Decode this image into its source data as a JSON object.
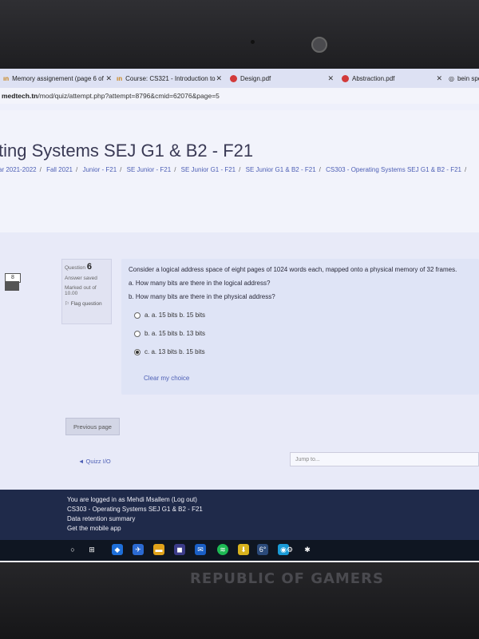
{
  "tabs": [
    {
      "label": "Memory assignement (page 6 of",
      "favicon": "moodle-icon"
    },
    {
      "label": "Course: CS321 - Introduction to",
      "favicon": "moodle-icon"
    },
    {
      "label": "Design.pdf",
      "favicon": "pdf-icon"
    },
    {
      "label": "Abstraction.pdf",
      "favicon": "pdf-icon"
    },
    {
      "label": "bein spo",
      "favicon": "globe-icon"
    }
  ],
  "url": {
    "domain": "medtech.tn",
    "path": "/mod/quiz/attempt.php?attempt=8796&cmid=62076&page=5"
  },
  "course_title": "ting Systems SEJ G1 & B2 - F21",
  "breadcrumbs": [
    "ar 2021-2022",
    "Fall 2021",
    "Junior - F21",
    "SE Junior - F21",
    "SE Junior G1 - F21",
    "SE Junior G1 & B2 - F21",
    "CS303 - Operating Systems SEJ G1 & B2 - F21"
  ],
  "quiz_nav": {
    "current": "8"
  },
  "question_info": {
    "label": "Question",
    "number": "6",
    "status": "Answer saved",
    "marked_line1": "Marked out of",
    "marked_line2": "10.00",
    "flag": "Flag question"
  },
  "question": {
    "text": "Consider a logical address space of eight pages of 1024 words each, mapped onto a physical memory of 32 frames.",
    "part_a": "a. How many bits are there in the logical address?",
    "part_b": "b. How many bits are there in the physical address?",
    "options": [
      {
        "label": "a. a. 15 bits  b. 15 bits",
        "selected": false
      },
      {
        "label": "b. a. 15 bits  b. 13 bits",
        "selected": false
      },
      {
        "label": "c. a. 13 bits  b. 15 bits",
        "selected": true
      }
    ],
    "clear": "Clear my choice"
  },
  "previous_button": "Previous page",
  "quiz_link": "◄ Quizz I/O",
  "jump_placeholder": "Jump to...",
  "footer": {
    "logged_in": "You are logged in as Mehdi Msallem (Log out)",
    "course": "CS303 - Operating Systems SEJ G1 & B2 - F21",
    "retention": "Data retention summary",
    "mobile": "Get the mobile app"
  },
  "taskbar_temp": "6°",
  "laptop_brand": "REPUBLIC OF GAMERS"
}
